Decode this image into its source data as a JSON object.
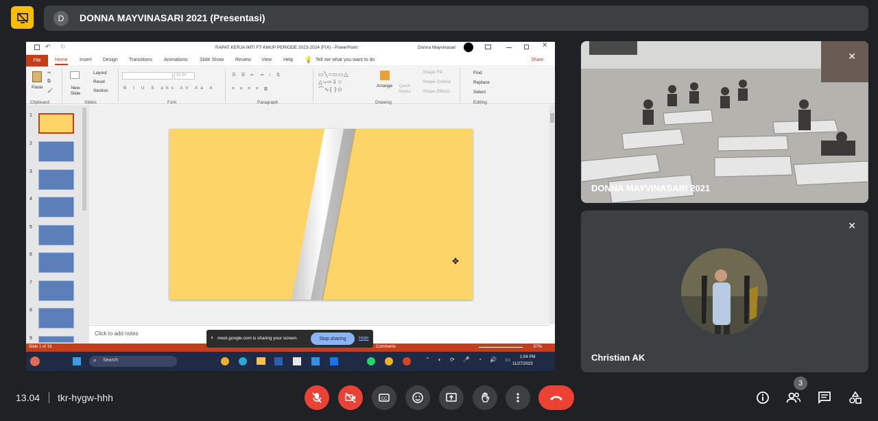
{
  "top": {
    "avatar_letter": "D",
    "title": "DONNA MAYVINASARI 2021 (Presentasi)",
    "badge_icon": "presentation-off-icon"
  },
  "ppt": {
    "doc_title": "RAPAT KERJA IMTI FT-KMUP PERIODE 2023-2024 (FIX)  -  PowerPoint",
    "user": "Donna Mayvinasari",
    "tabs": [
      "File",
      "Home",
      "Insert",
      "Design",
      "Transitions",
      "Animations",
      "Slide Show",
      "Review",
      "View",
      "Help"
    ],
    "tell_me": "Tell me what you want to do",
    "share": "Share",
    "ribbon": {
      "paste": "Paste",
      "new_slide": "New Slide",
      "layout": "Layout",
      "reset": "Reset",
      "section": "Section",
      "arrange": "Arrange",
      "quick_styles": "Quick Styles",
      "shape_fill": "Shape Fill",
      "shape_outline": "Shape Outline",
      "shape_effects": "Shape Effects",
      "find": "Find",
      "replace": "Replace",
      "select": "Select",
      "font_size": "10.5+",
      "groups": {
        "clipboard": "Clipboard",
        "slides": "Slides",
        "font": "Font",
        "paragraph": "Paragraph",
        "drawing": "Drawing",
        "editing": "Editing"
      }
    },
    "thumb_numbers": [
      "1",
      "2",
      "3",
      "4",
      "5",
      "6",
      "7",
      "8",
      "9"
    ],
    "notes_placeholder": "Click to add notes",
    "status_left": "Slide 1 of 19",
    "status_comments": "Comments",
    "zoom": "57%",
    "share_notice": "meet.google.com is sharing your screen.",
    "stop_sharing": "Stop sharing",
    "hide": "Hide",
    "taskbar": {
      "search": "Search",
      "time": "1:04 PM",
      "date": "11/27/2023"
    }
  },
  "participants": [
    {
      "name": "DONNA MAYVINASARI 2021"
    },
    {
      "name": "Christian AK"
    }
  ],
  "bottom": {
    "time": "13.04",
    "meeting_code": "tkr-hygw-hhh",
    "people_count": "3"
  }
}
